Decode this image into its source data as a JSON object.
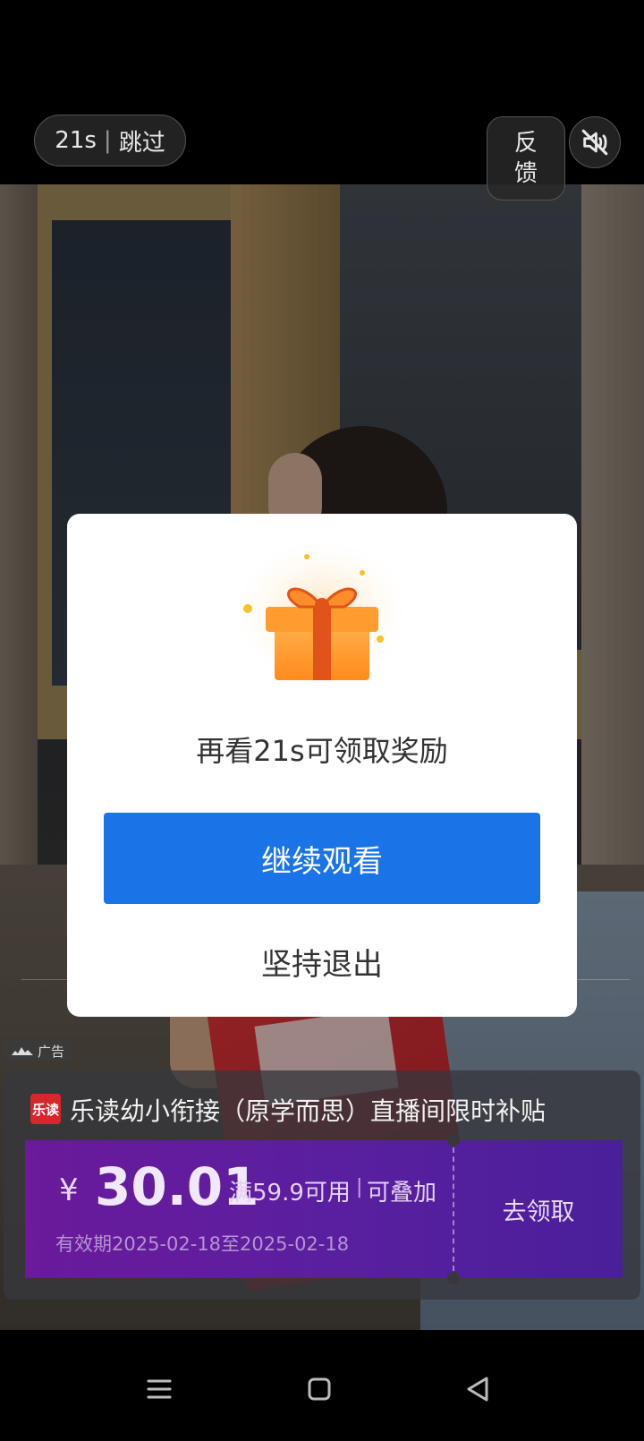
{
  "top": {
    "skip_countdown": "21s",
    "skip_separator": "|",
    "skip_label": "跳过",
    "feedback_line1": "反",
    "feedback_line2": "馈",
    "mute_icon": "speaker-muted-icon"
  },
  "dialog": {
    "message": "再看21s可领取奖励",
    "continue_label": "继续观看",
    "quit_label": "坚持退出",
    "gift_icon": "gift-box-icon"
  },
  "ad": {
    "tag": "广告",
    "brand_logo_text": "乐读",
    "title": "乐读幼小衔接（原学而思）直播间限时补贴",
    "coupon": {
      "currency": "¥",
      "amount": "30.01",
      "threshold": "满59.9可用",
      "separator": "|",
      "stackable": "可叠加",
      "validity": "有效期2025-02-18至2025-02-18",
      "claim_label": "去领取"
    }
  },
  "colors": {
    "primary_button": "#1a74e8",
    "coupon_purple": "#5a1fa0",
    "brand_red": "#d7262c"
  },
  "navbar": {
    "icons": [
      "menu-icon",
      "home-square-icon",
      "back-triangle-icon"
    ]
  }
}
